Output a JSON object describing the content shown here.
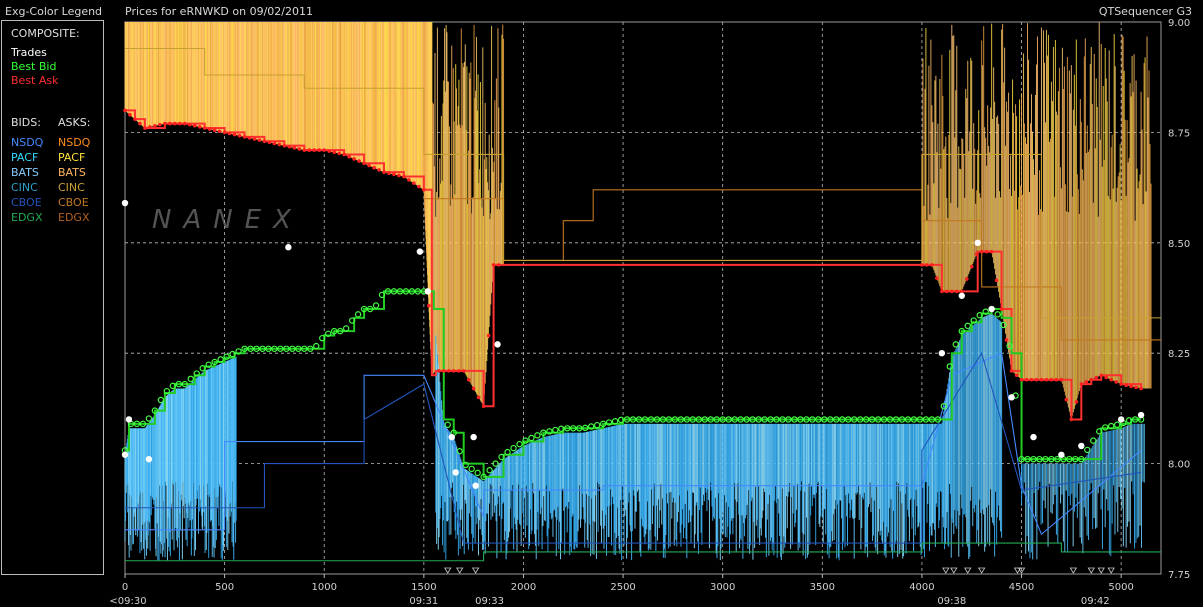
{
  "header": {
    "legend_title": "Exg-Color Legend",
    "chart_title": "Prices for  eRNWKD  on  09/02/2011",
    "app_name": "QTSequencer G3"
  },
  "legend": {
    "composite_label": "COMPOSITE:",
    "composite": [
      {
        "label": "Trades",
        "color": "#ffffff"
      },
      {
        "label": "Best Bid",
        "color": "#33ff33"
      },
      {
        "label": "Best Ask",
        "color": "#ff3030"
      }
    ],
    "bids_label": "BIDS:",
    "asks_label": "ASKS:",
    "bids": [
      {
        "label": "NSDQ",
        "color": "#4488ff"
      },
      {
        "label": "PACF",
        "color": "#33ddff"
      },
      {
        "label": "BATS",
        "color": "#88ccff"
      },
      {
        "label": "CINC",
        "color": "#2aa0c8"
      },
      {
        "label": "CBOE",
        "color": "#2255bb"
      },
      {
        "label": "EDGX",
        "color": "#22aa55"
      }
    ],
    "asks": [
      {
        "label": "NSDQ",
        "color": "#ff8c1a"
      },
      {
        "label": "PACF",
        "color": "#ffe040"
      },
      {
        "label": "BATS",
        "color": "#ffb860"
      },
      {
        "label": "CINC",
        "color": "#c8a030"
      },
      {
        "label": "CBOE",
        "color": "#c07820"
      },
      {
        "label": "EDGX",
        "color": "#b06020"
      }
    ]
  },
  "watermark": "NANEX",
  "chart_data": {
    "type": "line",
    "title": "Prices for  eRNWKD  on  09/02/2011",
    "x_axis": {
      "range": [
        0,
        5200
      ],
      "ticks": [
        0,
        500,
        1000,
        1500,
        2000,
        2500,
        3000,
        3500,
        4000,
        4500,
        5000
      ],
      "time_labels": [
        {
          "x": 0,
          "label": "<09:30"
        },
        {
          "x": 1500,
          "label": "09:31"
        },
        {
          "x": 1830,
          "label": "09:33"
        },
        {
          "x": 4150,
          "label": "09:38"
        },
        {
          "x": 4870,
          "label": "09:42"
        }
      ]
    },
    "y_axis": {
      "range": [
        7.75,
        9.0
      ],
      "ticks": [
        7.75,
        8.0,
        8.25,
        8.5,
        8.75,
        9.0
      ],
      "tick_labels": [
        "7.75",
        "8.00",
        "8.25",
        "8.50",
        "8.75",
        "9.00"
      ],
      "position": "right"
    },
    "grid": true,
    "series": [
      {
        "name": "Best Ask",
        "color": "#ff3030",
        "x": [
          0,
          50,
          100,
          200,
          300,
          400,
          500,
          600,
          700,
          800,
          900,
          1000,
          1100,
          1200,
          1300,
          1400,
          1500,
          1540,
          1560,
          1700,
          1800,
          1850,
          1900,
          4000,
          4050,
          4100,
          4200,
          4280,
          4350,
          4400,
          4450,
          4500,
          4600,
          4700,
          4750,
          4800,
          4850,
          4900,
          5000,
          5100
        ],
        "y": [
          8.8,
          8.78,
          8.76,
          8.77,
          8.77,
          8.76,
          8.75,
          8.74,
          8.73,
          8.72,
          8.71,
          8.71,
          8.7,
          8.68,
          8.66,
          8.65,
          8.62,
          8.2,
          8.21,
          8.21,
          8.13,
          8.45,
          8.45,
          8.45,
          8.45,
          8.39,
          8.39,
          8.48,
          8.48,
          8.35,
          8.21,
          8.19,
          8.19,
          8.19,
          8.1,
          8.18,
          8.19,
          8.2,
          8.18,
          8.17
        ]
      },
      {
        "name": "Best Bid",
        "color": "#33ff33",
        "x": [
          0,
          20,
          100,
          150,
          200,
          250,
          300,
          350,
          400,
          450,
          500,
          550,
          600,
          800,
          950,
          1000,
          1050,
          1100,
          1150,
          1200,
          1250,
          1300,
          1400,
          1500,
          1550,
          1600,
          1650,
          1700,
          1800,
          1900,
          2000,
          2100,
          2200,
          2300,
          2400,
          2500,
          2600,
          2700,
          2800,
          2900,
          3000,
          3100,
          3200,
          3300,
          3400,
          3500,
          3600,
          3700,
          3800,
          3900,
          4000,
          4050,
          4100,
          4150,
          4200,
          4250,
          4300,
          4350,
          4400,
          4450,
          4500,
          4600,
          4700,
          4800,
          4900,
          5000,
          5050,
          5100
        ],
        "y": [
          8.03,
          8.09,
          8.09,
          8.12,
          8.16,
          8.18,
          8.18,
          8.2,
          8.22,
          8.23,
          8.24,
          8.25,
          8.26,
          8.26,
          8.26,
          8.29,
          8.3,
          8.3,
          8.33,
          8.35,
          8.35,
          8.39,
          8.39,
          8.39,
          8.35,
          8.1,
          8.07,
          8.0,
          7.97,
          8.02,
          8.05,
          8.07,
          8.08,
          8.08,
          8.09,
          8.1,
          8.1,
          8.1,
          8.1,
          8.1,
          8.1,
          8.1,
          8.1,
          8.1,
          8.1,
          8.1,
          8.1,
          8.1,
          8.1,
          8.1,
          8.1,
          8.1,
          8.1,
          8.25,
          8.3,
          8.32,
          8.34,
          8.35,
          8.33,
          8.25,
          8.01,
          8.01,
          8.01,
          8.01,
          8.08,
          8.09,
          8.1,
          8.1
        ]
      },
      {
        "name": "NSDQ",
        "color": "#4488ff",
        "x": [
          0,
          500,
          500,
          1200,
          1200,
          1500,
          1800,
          1800,
          2400,
          2400,
          4000,
          4150,
          4400,
          4500,
          4600,
          5100
        ],
        "y": [
          7.85,
          7.85,
          8.05,
          8.05,
          8.2,
          8.2,
          7.88,
          7.94,
          7.94,
          7.95,
          7.95,
          8.2,
          8.25,
          7.95,
          7.84,
          8.03
        ]
      },
      {
        "name": "CBOE",
        "color": "#2255bb",
        "x": [
          0,
          700,
          700,
          1200,
          1200,
          1500,
          1700,
          1700,
          4000,
          4000,
          4300,
          4500,
          5100
        ],
        "y": [
          7.9,
          7.9,
          8.0,
          8.0,
          8.1,
          8.18,
          7.82,
          7.82,
          7.82,
          8.03,
          8.25,
          7.94,
          7.98
        ]
      },
      {
        "name": "EDGX",
        "color": "#22aa55",
        "x": [
          0,
          1800,
          1800,
          4000,
          4000,
          4700,
          4700,
          5200
        ],
        "y": [
          7.78,
          7.78,
          7.8,
          7.8,
          7.82,
          7.82,
          7.8,
          7.8
        ]
      },
      {
        "name": "CBOE",
        "color": "#c07820",
        "x": [
          1500,
          1900,
          1900,
          2200,
          2200,
          2350,
          2350,
          4000,
          4000,
          4300,
          4300,
          4700,
          4700,
          5200
        ],
        "y": [
          8.6,
          8.6,
          8.46,
          8.46,
          8.55,
          8.55,
          8.62,
          8.62,
          8.55,
          8.55,
          8.4,
          8.4,
          8.28,
          8.28
        ]
      },
      {
        "name": "CINC",
        "color": "#c8a030",
        "x": [
          0,
          400,
          400,
          900,
          900,
          1500,
          1500,
          1900,
          1900,
          4000,
          4000,
          4600,
          4600,
          5200
        ],
        "y": [
          8.94,
          8.94,
          8.88,
          8.88,
          8.85,
          8.85,
          8.7,
          8.7,
          8.46,
          8.46,
          8.7,
          8.7,
          8.33,
          8.33
        ]
      }
    ],
    "trades_approx": [
      {
        "x": 0,
        "y": 8.59
      },
      {
        "x": 20,
        "y": 8.1
      },
      {
        "x": 0,
        "y": 8.02
      },
      {
        "x": 120,
        "y": 8.01
      },
      {
        "x": 820,
        "y": 8.49
      },
      {
        "x": 1480,
        "y": 8.48
      },
      {
        "x": 1520,
        "y": 8.39
      },
      {
        "x": 1640,
        "y": 8.06
      },
      {
        "x": 1660,
        "y": 7.98
      },
      {
        "x": 1750,
        "y": 8.06
      },
      {
        "x": 1870,
        "y": 8.27
      },
      {
        "x": 1760,
        "y": 7.95
      },
      {
        "x": 4100,
        "y": 8.25
      },
      {
        "x": 4200,
        "y": 8.38
      },
      {
        "x": 4280,
        "y": 8.5
      },
      {
        "x": 4350,
        "y": 8.35
      },
      {
        "x": 4450,
        "y": 8.15
      },
      {
        "x": 4560,
        "y": 8.06
      },
      {
        "x": 4700,
        "y": 8.02
      },
      {
        "x": 4800,
        "y": 8.04
      },
      {
        "x": 5000,
        "y": 8.1
      },
      {
        "x": 5100,
        "y": 8.11
      }
    ]
  }
}
